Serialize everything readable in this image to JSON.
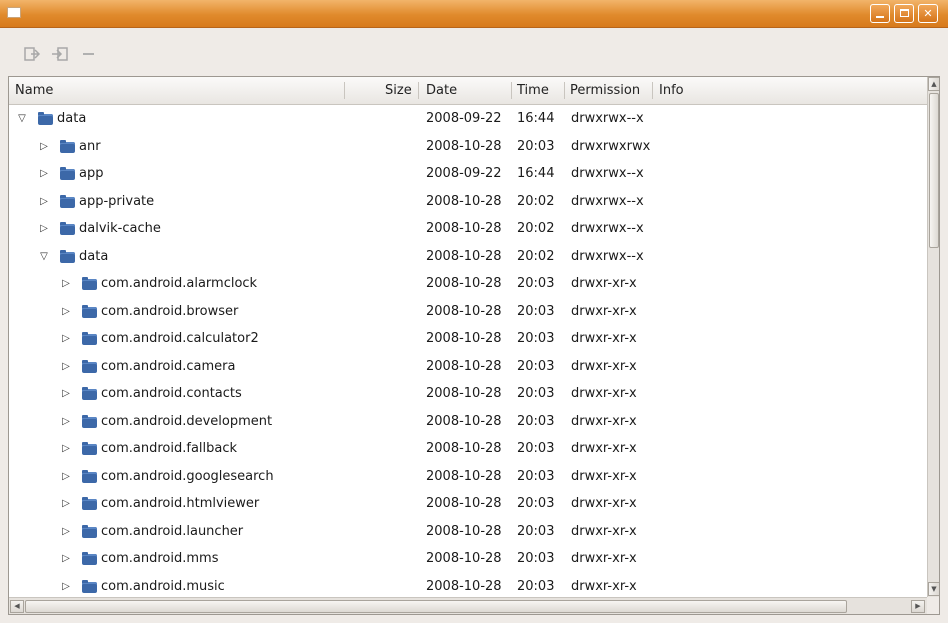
{
  "window": {
    "title": ""
  },
  "toolbar": {
    "icons": [
      "pull-file-icon",
      "push-file-icon",
      "delete-icon"
    ]
  },
  "columns": {
    "name": "Name",
    "size": "Size",
    "date": "Date",
    "time": "Time",
    "permission": "Permission",
    "info": "Info"
  },
  "rows": [
    {
      "depth": 0,
      "expanded": true,
      "name": "data",
      "date": "2008-09-22",
      "time": "16:44",
      "permission": "drwxrwx--x"
    },
    {
      "depth": 1,
      "expanded": false,
      "name": "anr",
      "date": "2008-10-28",
      "time": "20:03",
      "permission": "drwxrwxrwx"
    },
    {
      "depth": 1,
      "expanded": false,
      "name": "app",
      "date": "2008-09-22",
      "time": "16:44",
      "permission": "drwxrwx--x"
    },
    {
      "depth": 1,
      "expanded": false,
      "name": "app-private",
      "date": "2008-10-28",
      "time": "20:02",
      "permission": "drwxrwx--x"
    },
    {
      "depth": 1,
      "expanded": false,
      "name": "dalvik-cache",
      "date": "2008-10-28",
      "time": "20:02",
      "permission": "drwxrwx--x"
    },
    {
      "depth": 1,
      "expanded": true,
      "name": "data",
      "date": "2008-10-28",
      "time": "20:02",
      "permission": "drwxrwx--x"
    },
    {
      "depth": 2,
      "expanded": false,
      "name": "com.android.alarmclock",
      "date": "2008-10-28",
      "time": "20:03",
      "permission": "drwxr-xr-x"
    },
    {
      "depth": 2,
      "expanded": false,
      "name": "com.android.browser",
      "date": "2008-10-28",
      "time": "20:03",
      "permission": "drwxr-xr-x"
    },
    {
      "depth": 2,
      "expanded": false,
      "name": "com.android.calculator2",
      "date": "2008-10-28",
      "time": "20:03",
      "permission": "drwxr-xr-x"
    },
    {
      "depth": 2,
      "expanded": false,
      "name": "com.android.camera",
      "date": "2008-10-28",
      "time": "20:03",
      "permission": "drwxr-xr-x"
    },
    {
      "depth": 2,
      "expanded": false,
      "name": "com.android.contacts",
      "date": "2008-10-28",
      "time": "20:03",
      "permission": "drwxr-xr-x"
    },
    {
      "depth": 2,
      "expanded": false,
      "name": "com.android.development",
      "date": "2008-10-28",
      "time": "20:03",
      "permission": "drwxr-xr-x"
    },
    {
      "depth": 2,
      "expanded": false,
      "name": "com.android.fallback",
      "date": "2008-10-28",
      "time": "20:03",
      "permission": "drwxr-xr-x"
    },
    {
      "depth": 2,
      "expanded": false,
      "name": "com.android.googlesearch",
      "date": "2008-10-28",
      "time": "20:03",
      "permission": "drwxr-xr-x"
    },
    {
      "depth": 2,
      "expanded": false,
      "name": "com.android.htmlviewer",
      "date": "2008-10-28",
      "time": "20:03",
      "permission": "drwxr-xr-x"
    },
    {
      "depth": 2,
      "expanded": false,
      "name": "com.android.launcher",
      "date": "2008-10-28",
      "time": "20:03",
      "permission": "drwxr-xr-x"
    },
    {
      "depth": 2,
      "expanded": false,
      "name": "com.android.mms",
      "date": "2008-10-28",
      "time": "20:03",
      "permission": "drwxr-xr-x"
    },
    {
      "depth": 2,
      "expanded": false,
      "name": "com.android.music",
      "date": "2008-10-28",
      "time": "20:03",
      "permission": "drwxr-xr-x"
    }
  ]
}
